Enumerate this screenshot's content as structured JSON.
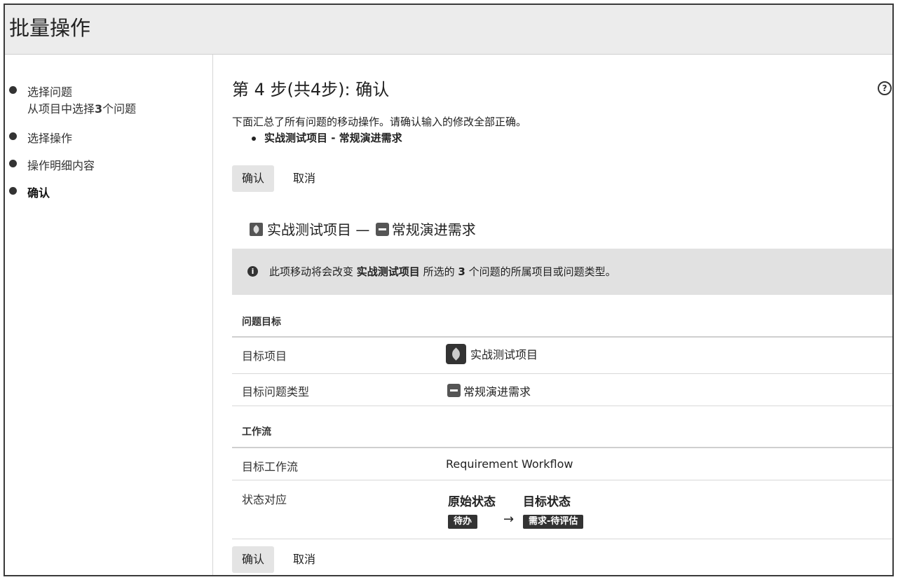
{
  "header": {
    "title": "批量操作"
  },
  "sidebar": {
    "steps": [
      {
        "label": "选择问题",
        "sub_prefix": "从项目中选择",
        "sub_count": "3",
        "sub_suffix": "个问题"
      },
      {
        "label": "选择操作"
      },
      {
        "label": "操作明细内容"
      },
      {
        "label": "确认"
      }
    ]
  },
  "main": {
    "title": "第 4 步(共4步): 确认",
    "description": "下面汇总了所有问题的移动操作。请确认输入的修改全部正确。",
    "summary_item": "实战测试项目 - 常规演进需求",
    "confirm_label": "确认",
    "cancel_label": "取消",
    "move_project": "实战测试项目",
    "move_separator": "—",
    "move_issue_type": "常规演进需求",
    "info": {
      "prefix": "此项移动将会改变",
      "project": "实战测试项目",
      "mid": "所选的",
      "count": "3",
      "suffix": "个问题的所属项目或问题类型。"
    },
    "section_target": "问题目标",
    "target_project_label": "目标项目",
    "target_project_value": "实战测试项目",
    "target_type_label": "目标问题类型",
    "target_type_value": "常规演进需求",
    "section_workflow": "工作流",
    "target_workflow_label": "目标工作流",
    "target_workflow_value": "Requirement Workflow",
    "status_map_label": "状态对应",
    "status_original_header": "原始状态",
    "status_target_header": "目标状态",
    "status_original": "待办",
    "status_arrow": "→",
    "status_target": "需求-待评估"
  }
}
